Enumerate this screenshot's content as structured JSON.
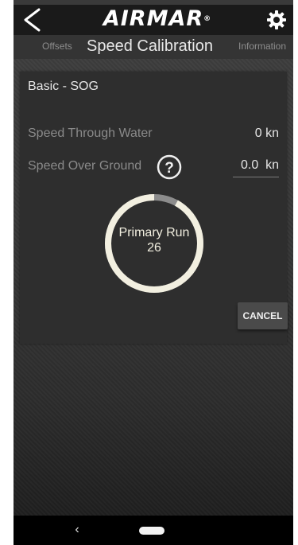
{
  "header": {
    "brand": "AIRMAR",
    "brand_mark": "®",
    "back_icon": "chevron-left-icon",
    "settings_icon": "gear-icon"
  },
  "tabs": {
    "left": "Offsets",
    "active": "Speed Calibration",
    "right": "Information"
  },
  "panel": {
    "title": "Basic - SOG",
    "speed_through_water": {
      "label": "Speed Through Water",
      "value": "0 kn"
    },
    "speed_over_ground": {
      "label": "Speed Over Ground",
      "value": "0.0  kn",
      "help_icon": "question-circle-icon"
    },
    "progress": {
      "label": "Primary Run",
      "count": "26",
      "fraction": 0.92
    },
    "cancel_label": "CANCEL"
  },
  "navbar": {
    "back_icon": "nav-back-icon",
    "home_icon": "nav-home-icon"
  },
  "colors": {
    "ring_progress": "#f2efe0",
    "ring_track": "#8c8c8c",
    "panel": "#2e2e2e",
    "topbar": "#1a1a1a"
  }
}
